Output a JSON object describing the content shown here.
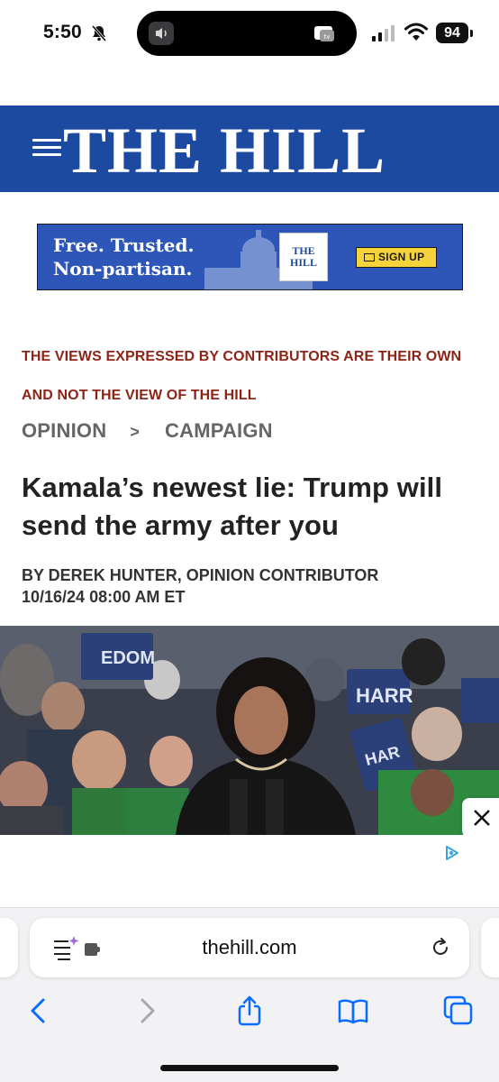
{
  "status_bar": {
    "time": "5:50",
    "battery": "94"
  },
  "masthead": {
    "logo": "THE HILL"
  },
  "ad_banner": {
    "line1": "Free. Trusted.",
    "line2": "Non-partisan.",
    "logo_line1": "THE",
    "logo_line2": "HILL",
    "signup_label": "SIGN UP"
  },
  "article": {
    "disclaimer": "THE VIEWS EXPRESSED BY CONTRIBUTORS ARE THEIR OWN AND NOT THE VIEW OF THE HILL",
    "breadcrumb": [
      "OPINION",
      "CAMPAIGN"
    ],
    "breadcrumb_separator": ">",
    "headline": "Kamala’s newest lie: Trump will send the army after you",
    "byline": "BY DEREK HUNTER, OPINION CONTRIBUTOR",
    "timestamp": "10/16/24 08:00 AM ET",
    "photo_signs": [
      "EDOM",
      "HARR",
      "HAR"
    ]
  },
  "browser": {
    "url": "thehill.com",
    "icons": {
      "page_menu": "page-menu-icon",
      "reload": "reload-icon",
      "back": "back-icon",
      "forward": "forward-icon",
      "share": "share-icon",
      "bookmarks": "book-icon",
      "tabs": "tabs-icon"
    }
  },
  "colors": {
    "masthead_blue": "#1c4aa0",
    "disclaimer_red": "#8d2418",
    "ios_blue": "#0a6cff"
  }
}
